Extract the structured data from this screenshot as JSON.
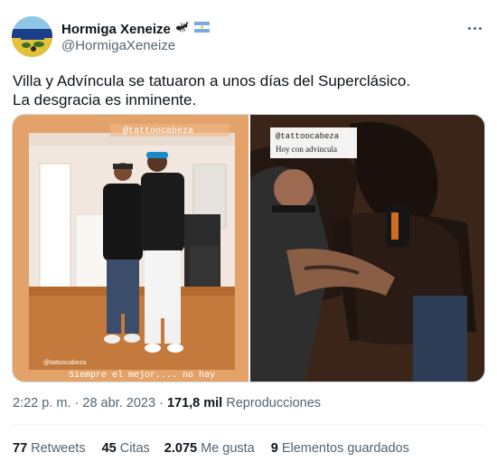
{
  "author": {
    "display_name": "Hormiga Xeneize",
    "handle": "@HormigaXeneize",
    "badge_icons": [
      "ant-icon",
      "argentina-flag-icon"
    ]
  },
  "tweet": {
    "lines": [
      "Villa y Advíncula se tatuaron a unos días del Superclásico.",
      "La desgracia es inminente."
    ]
  },
  "media": {
    "left_photo": {
      "caption_top": "@tattoocabeza",
      "caption_bottom_handle": "@tattoocabeza",
      "caption_bottom_text": "Siempre el mejor.... no hay"
    },
    "right_photo": {
      "caption_line1": "@tattoocabeza",
      "caption_line2": "Hoy con advincula"
    }
  },
  "meta": {
    "time": "2:22 p. m.",
    "separator": "·",
    "date": "28 abr. 2023",
    "views_count": "171,8 mil",
    "views_label": "Reproducciones"
  },
  "stats": [
    {
      "count": "77",
      "label": "Retweets"
    },
    {
      "count": "45",
      "label": "Citas"
    },
    {
      "count": "2.075",
      "label": "Me gusta"
    },
    {
      "count": "9",
      "label": "Elementos guardados"
    }
  ],
  "colors": {
    "text_primary": "#0f1419",
    "text_secondary": "#536471",
    "divider": "#eff3f4",
    "left_photo_bg": "#e3a26a",
    "right_photo_bg": "#2d1c16"
  }
}
